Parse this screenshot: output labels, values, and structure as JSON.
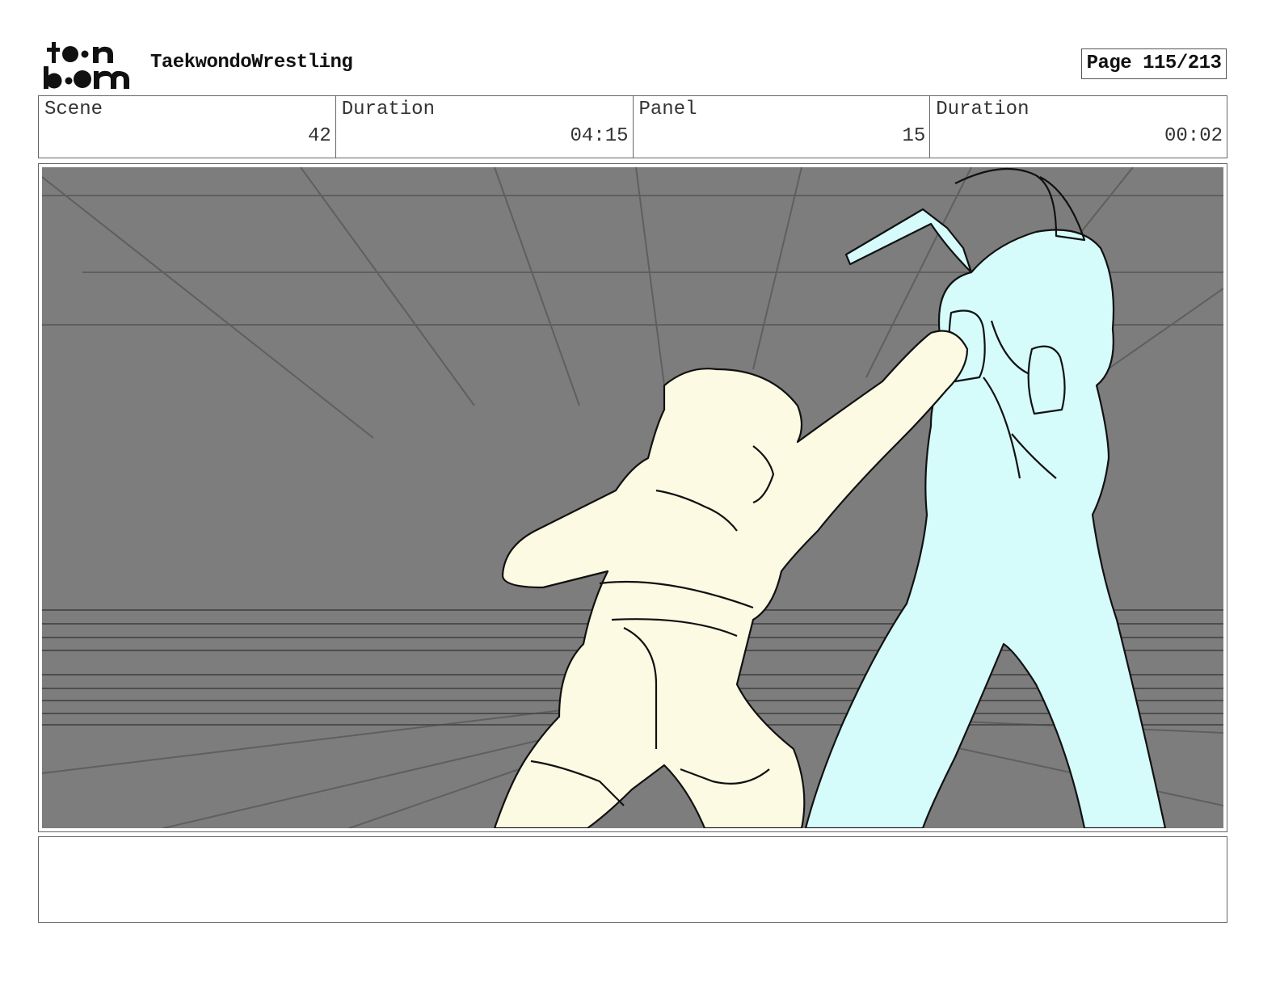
{
  "header": {
    "logo_text": "toon boom",
    "project_title": "TaekwondoWrestling",
    "page_label": "Page 115/213"
  },
  "info": {
    "scene_label": "Scene",
    "scene_value": "42",
    "scene_duration_label": "Duration",
    "scene_duration_value": "04:15",
    "panel_label": "Panel",
    "panel_value": "15",
    "panel_duration_label": "Duration",
    "panel_duration_value": "00:02"
  },
  "panel": {
    "colors": {
      "background": "#7d7d7d",
      "fighter_left": "#fdfae3",
      "fighter_right": "#d6fbfb",
      "outline": "#111111"
    }
  },
  "notes": {
    "text": ""
  }
}
